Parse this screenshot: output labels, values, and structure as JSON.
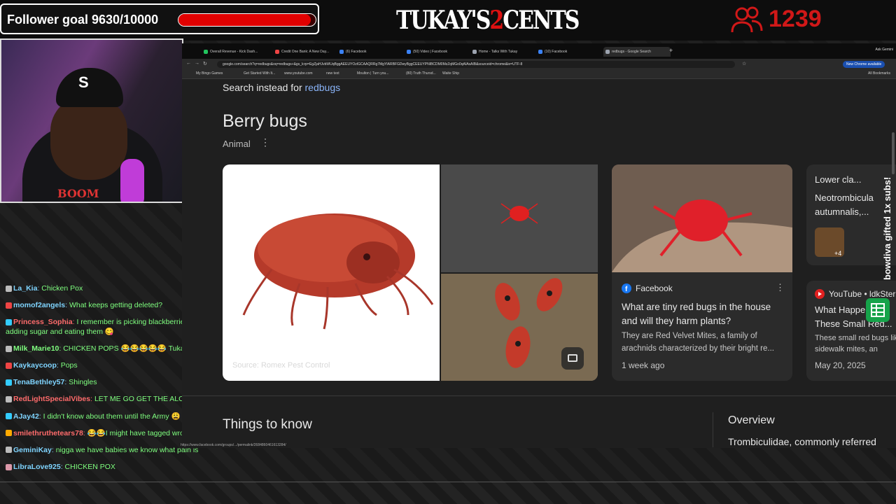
{
  "overlay": {
    "follower_goal": "Follower goal 9630/10000",
    "follower_progress": 0.963,
    "brand_part1": "TUKAY'S",
    "brand_part2": "2",
    "brand_part3": "CENTS",
    "viewer_count": "1239",
    "gift_banner": "bowdiva gifted 1x subs!"
  },
  "chat": [
    {
      "user": "La_Kia",
      "msg": "Chicken Pox",
      "user_color": "#7fd4ff",
      "msg_color": "#7fff7f"
    },
    {
      "user": "momof2angels",
      "msg": "What keeps getting deleted?",
      "user_color": "#7fd4ff",
      "msg_color": "#7fff7f"
    },
    {
      "user": "Princess_Sophia",
      "msg": "I remember is picking blackberries washing them adding sugar and eating them 😋",
      "user_color": "#ff6b6b",
      "msg_color": "#7fff7f"
    },
    {
      "user": "Milk_Marie10",
      "msg": "CHICKEN POPS 😂😂😂😂😂 Tukay go to hell lmaofao",
      "user_color": "#7fff7f",
      "msg_color": "#7fff7f"
    },
    {
      "user": "Kaykaycoop",
      "msg": "Pops",
      "user_color": "#7fd4ff",
      "msg_color": "#7fff7f"
    },
    {
      "user": "TenaBethley57",
      "msg": "Shingles",
      "user_color": "#7fd4ff",
      "msg_color": "#7fff7f"
    },
    {
      "user": "RedLightSpecialVibes",
      "msg": "LET ME GO GET THE ALCOHOL I'M ITCHING",
      "user_color": "#ff6b6b",
      "msg_color": "#7fff7f"
    },
    {
      "user": "AJay42",
      "msg": "I didn't know about them until the Army 😩",
      "user_color": "#7fd4ff",
      "msg_color": "#7fff7f"
    },
    {
      "user": "smilethruthetears78",
      "msg": "😂😂I might have tagged wrong person",
      "user_color": "#ff6b6b",
      "msg_color": "#7fff7f"
    },
    {
      "user": "GeminiKay",
      "msg": "nigga we have babies we know what pain is",
      "user_color": "#7fd4ff",
      "msg_color": "#7fff7f"
    },
    {
      "user": "LibraLove925",
      "msg": "CHICKEN POX",
      "user_color": "#7fd4ff",
      "msg_color": "#7fff7f"
    }
  ],
  "browser": {
    "tabs": [
      {
        "label": "Overall Revenue - Kick Dash...",
        "color": "#22c55e"
      },
      {
        "label": "Credit One Bank: A New Day...",
        "color": "#ef4444"
      },
      {
        "label": "(6) Facebook",
        "color": "#3b82f6"
      },
      {
        "label": "(50) Video | Facebook",
        "color": "#3b82f6"
      },
      {
        "label": "Home - Talks With Tukay",
        "color": "#9ca3af"
      },
      {
        "label": "(10) Facebook",
        "color": "#3b82f6"
      },
      {
        "label": "redbugs - Google Search",
        "color": "#9ca3af"
      }
    ],
    "new_tab": "+",
    "ask_gemini": "Ask Gemini",
    "url": "google.com/search?q=redbugs&oq=redbugs+&gs_lcrp=EgZjaHJvbWUqBggAEEUYOzIGCAAQRRg7MgYIARBFGDwyBggCEEUYPNIBCDM0MzZqMGo0qAIAsAIB&sourceid=chrome&ie=UTF-8",
    "chrome_available": "New Chrome available",
    "bookmarks": [
      "My Bingo Games",
      "Get Started With It...",
      "www.youtube.com",
      "new text",
      "Moulton | Turn you...",
      "(80) Truth Thursd...",
      "Waite Ship"
    ],
    "all_bookmarks": "All Bookmarks"
  },
  "search": {
    "instead_prefix": "Search instead for",
    "instead_link": "redbugs",
    "kp_title": "Berry bugs",
    "kp_subtitle": "Animal",
    "image_source": "Source: Romex Pest Control",
    "fb_card": {
      "source": "Facebook",
      "title": "What are tiny red bugs in the house and will they harm plants?",
      "body": "They are Red Velvet Mites, a family of arachnids characterized by their bright re...",
      "date": "1 week ago"
    },
    "lower_card": {
      "title": "Lower cla...",
      "body": "Neotrombicula autumnalis,...",
      "extra": "+4"
    },
    "yt_card": {
      "source": "YouTube • ldkStern",
      "title": "What Happens To These Small Red...",
      "body": "These small red bugs like sidewalk mites, an",
      "date": "May 20, 2025"
    },
    "things_to_know": "Things to know",
    "overview": "Overview",
    "overview_text": "Trombiculidae, commonly referred",
    "status_url": "https://www.facebook.com/groups/.../permalink/2684860461613284/"
  },
  "colors": {
    "accent_link": "#8ab4f8",
    "goal_fill": "#e00000",
    "viewer_red": "#d01818"
  }
}
